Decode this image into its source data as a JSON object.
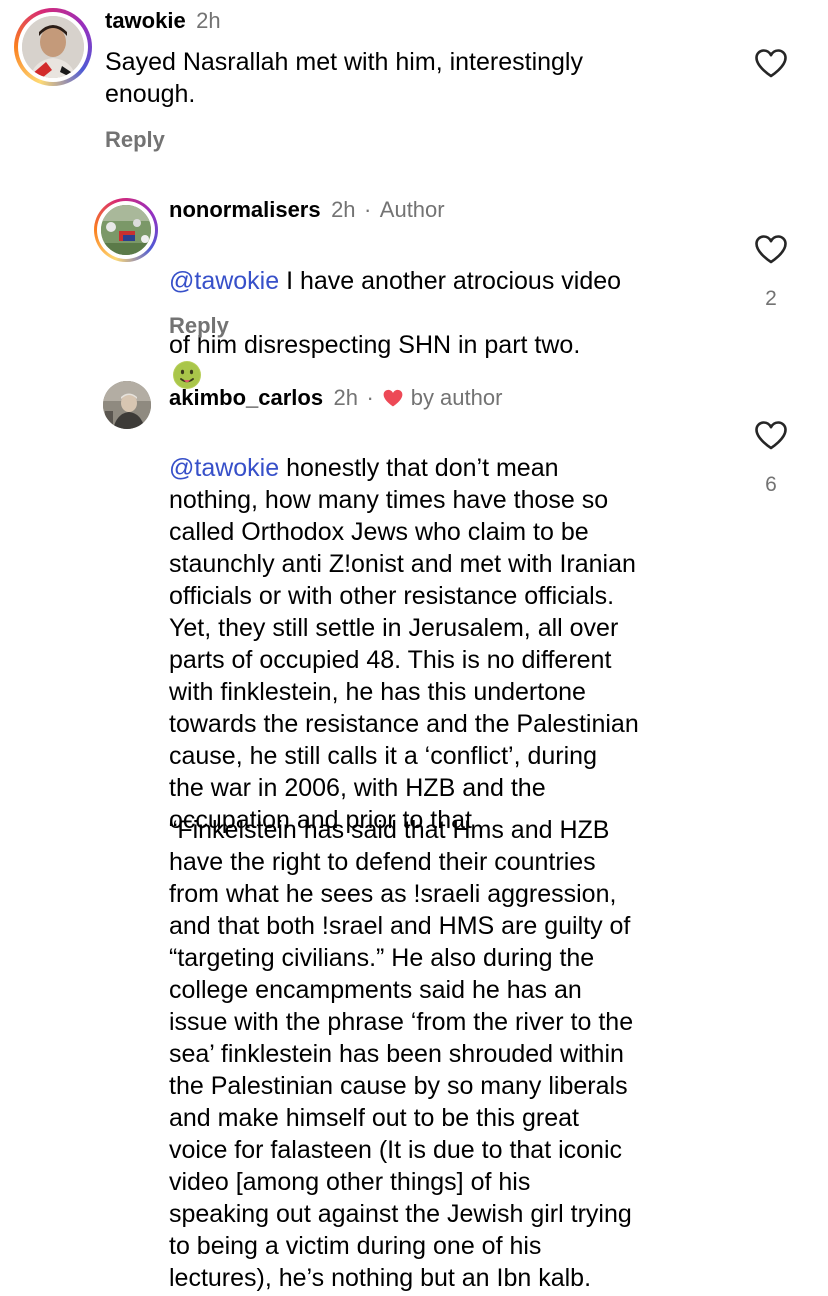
{
  "comments": [
    {
      "username": "tawokie",
      "time": "2h",
      "text": "Sayed Nasrallah met with him, interestingly\nenough.",
      "reply_label": "Reply",
      "likes": ""
    },
    {
      "username": "nonormalisers",
      "time": "2h",
      "sep": "·",
      "author_label": "Author",
      "mention": "@tawokie",
      "text_line1": " I have another atrocious video",
      "text_line2": "of him disrespecting SHN in part two.",
      "reply_label": "Reply",
      "likes": "2"
    },
    {
      "username": "akimbo_carlos",
      "time": "2h",
      "sep": "·",
      "by_author_label": "by author",
      "mention": "@tawokie",
      "text_first": " honestly that don’t mean",
      "text_rest": "nothing, how many times have those so\ncalled Orthodox Jews who claim to be\nstaunchly anti Z!onist and met with Iranian\nofficials or with other resistance officials.\nYet, they still settle in Jerusalem, all over\nparts of occupied 48. This is no different\nwith finklestein, he has this undertone\ntowards the resistance and the Palestinian\ncause, he still calls it a ‘conflict’, during\nthe war in 2006, with HZB and the\noccupation and prior to that",
      "text_para2": "“Finkelstein has said that Hms and HZB\nhave the right to defend their countries\nfrom what he sees as !sraeli aggression,\nand that both !srael and HMS are guilty of\n“targeting civilians.” He also during the\ncollege encampments said he has an\nissue with the phrase ‘from the river to the\nsea’ finklestein has been shrouded within\nthe Palestinian cause by so many liberals\nand make himself out to be this great\nvoice for falasteen (It is due to that iconic\nvideo [among other things] of his\nspeaking out against the Jewish girl trying\nto being a victim during one of his\nlectures), he’s nothing but an Ibn kalb.",
      "likes": "6"
    }
  ],
  "icons": {
    "like": "heart-outline-icon",
    "author_like": "red-heart-icon",
    "emoji": "nauseated-face-emoji"
  },
  "colors": {
    "mention": "#3750c9",
    "meta": "#737373",
    "heart_red": "#ed4956"
  }
}
